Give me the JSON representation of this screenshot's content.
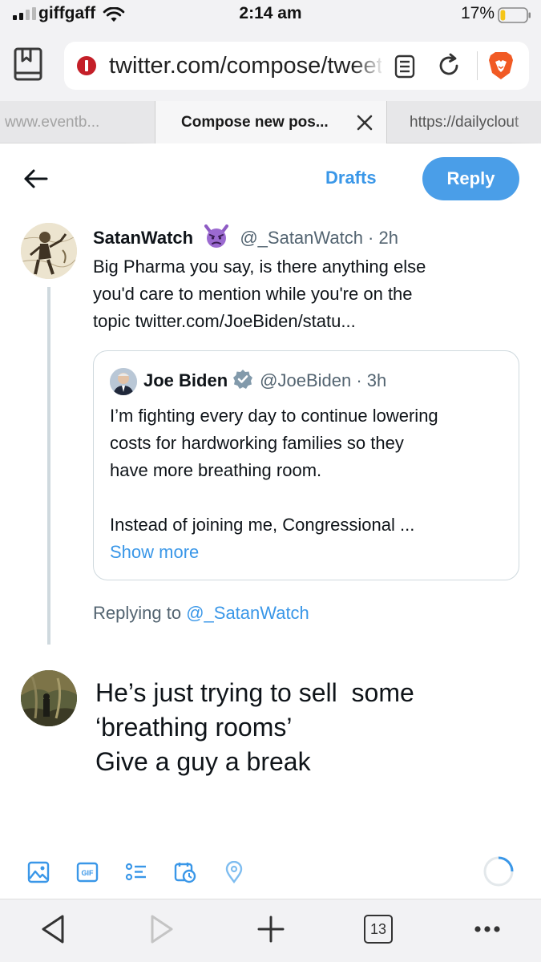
{
  "status_bar": {
    "carrier": "giffgaff",
    "time": "2:14 am",
    "battery_percent": "17%",
    "battery_level": 0.17,
    "signal_bars_active": 2,
    "signal_bars_total": 4
  },
  "address_bar": {
    "url": "twitter.com/compose/tweet",
    "icons": [
      "reader-mode-icon",
      "site-info-icon",
      "page-icon",
      "reload-icon",
      "brave-shields-icon"
    ]
  },
  "tabs": [
    {
      "title": "www.eventb...",
      "active": false
    },
    {
      "title": "Compose new pos...",
      "active": true
    },
    {
      "title": "https://dailyclout",
      "active": false
    }
  ],
  "compose_header": {
    "drafts_label": "Drafts",
    "reply_label": "Reply",
    "reply_button_color": "#4a9ee8"
  },
  "original_tweet": {
    "name": "SatanWatch",
    "emoji": "angry-devil-emoji",
    "handle_time": "@_SatanWatch · 2h",
    "body_lines": [
      "Big Pharma you say, is there anything else",
      "you'd care to mention while you're on the",
      "topic twitter.com/JoeBiden/statu..."
    ]
  },
  "quoted_tweet": {
    "name": "Joe Biden",
    "verified": true,
    "handle_time": "@JoeBiden · 3h",
    "body_lines": [
      "I’m fighting every day to continue lowering",
      "costs for hardworking families so they",
      "have more breathing room."
    ],
    "body_lines_2": [
      "Instead of joining me, Congressional ..."
    ],
    "show_more": "Show more"
  },
  "replying_to": {
    "prefix": "Replying to",
    "handle": "@_SatanWatch"
  },
  "reply_draft": {
    "lines": [
      "He’s just trying to sell  some",
      "‘breathing rooms’",
      "Give a guy a break"
    ]
  },
  "compose_toolbar": {
    "icons": [
      "image-icon",
      "gif-icon",
      "poll-icon",
      "schedule-icon",
      "location-icon"
    ],
    "gif_label": "GIF",
    "accent_color": "#3a97e8"
  },
  "bottom_bar": {
    "tab_count": "13",
    "icons": [
      "back-icon",
      "forward-icon",
      "new-tab-icon",
      "tabs-icon",
      "more-icon"
    ]
  }
}
